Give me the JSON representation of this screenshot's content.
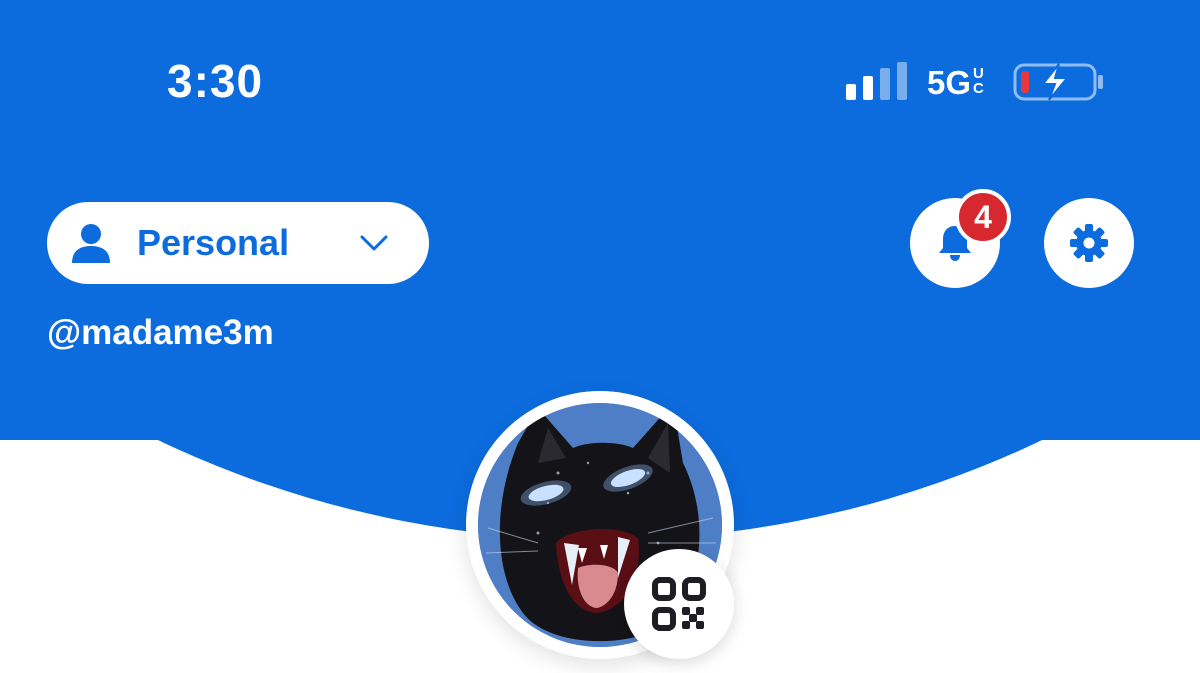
{
  "status_bar": {
    "time": "3:30",
    "network": "5G",
    "network_suffix_top": "U",
    "network_suffix_bottom": "C",
    "signal_icon": "signal-bars-icon",
    "battery_icon": "battery-charging-icon"
  },
  "account": {
    "type_label": "Personal",
    "username": "@madame3m"
  },
  "notifications": {
    "count": "4"
  },
  "colors": {
    "brand_blue": "#0C6CDE",
    "badge_red": "#D8282F",
    "battery_low_red": "#E8383D"
  },
  "icons": {
    "account": "person-icon",
    "dropdown": "chevron-down-icon",
    "notifications": "bell-icon",
    "settings": "gear-icon",
    "qr": "qr-code-icon"
  }
}
